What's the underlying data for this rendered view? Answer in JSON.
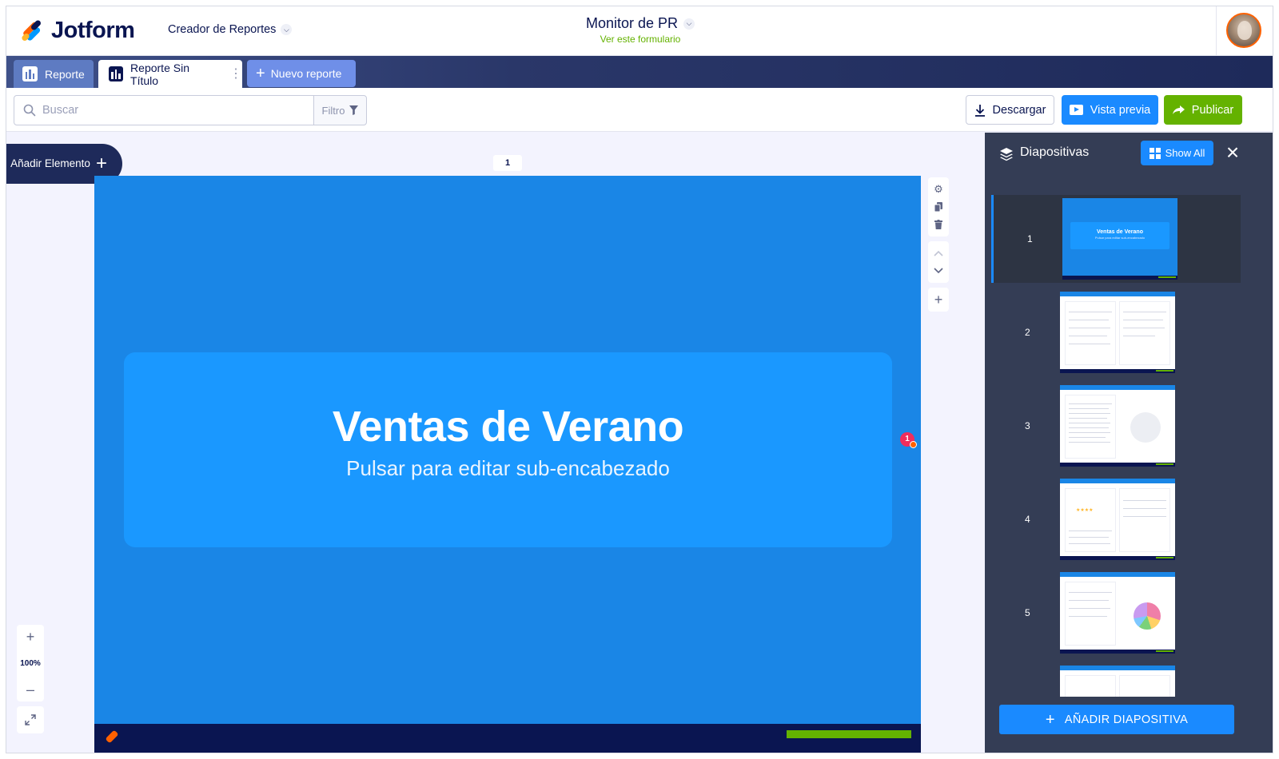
{
  "header": {
    "brand": "Jotform",
    "app_name": "Creador de Reportes",
    "form_title": "Monitor de PR",
    "form_link": "Ver este formulario"
  },
  "tabs": [
    {
      "label": "Reporte",
      "active": false
    },
    {
      "label": "Reporte Sin Título",
      "active": true
    },
    {
      "label": "Nuevo reporte",
      "active": false
    }
  ],
  "toolbar": {
    "search_placeholder": "Buscar",
    "filter_label": "Filtro",
    "download_label": "Descargar",
    "preview_label": "Vista previa",
    "publish_label": "Publicar"
  },
  "canvas": {
    "add_element_label": "Añadir Elemento",
    "page_number": "1",
    "slide_title": "Ventas de Verano",
    "slide_subtitle": "Pulsar para editar sub-encabezado",
    "comment_count": "1",
    "zoom_level": "100%"
  },
  "slides_panel": {
    "title": "Diapositivas",
    "show_all_label": "Show All",
    "add_slide_label": "AÑADIR DIAPOSITIVA",
    "thumbnails": [
      {
        "number": "1",
        "active": true,
        "title": "Ventas de Verano",
        "subtitle": "Pulsar para editar sub-encabezado"
      },
      {
        "number": "2",
        "active": false
      },
      {
        "number": "3",
        "active": false
      },
      {
        "number": "4",
        "active": false
      },
      {
        "number": "5",
        "active": false
      }
    ]
  },
  "colors": {
    "brand_navy": "#0a1551",
    "accent_blue": "#1a8aff",
    "publish_green": "#64b200",
    "slide_bg": "#1a86e6",
    "panel_bg": "#343d55"
  },
  "icons": [
    "search-icon",
    "filter-icon",
    "download-icon",
    "play-icon",
    "share-arrow-icon",
    "gear-icon",
    "copy-icon",
    "trash-icon",
    "chevron-up-icon",
    "chevron-down-icon",
    "plus-icon",
    "layers-icon",
    "grid-icon",
    "close-icon",
    "expand-icon"
  ]
}
